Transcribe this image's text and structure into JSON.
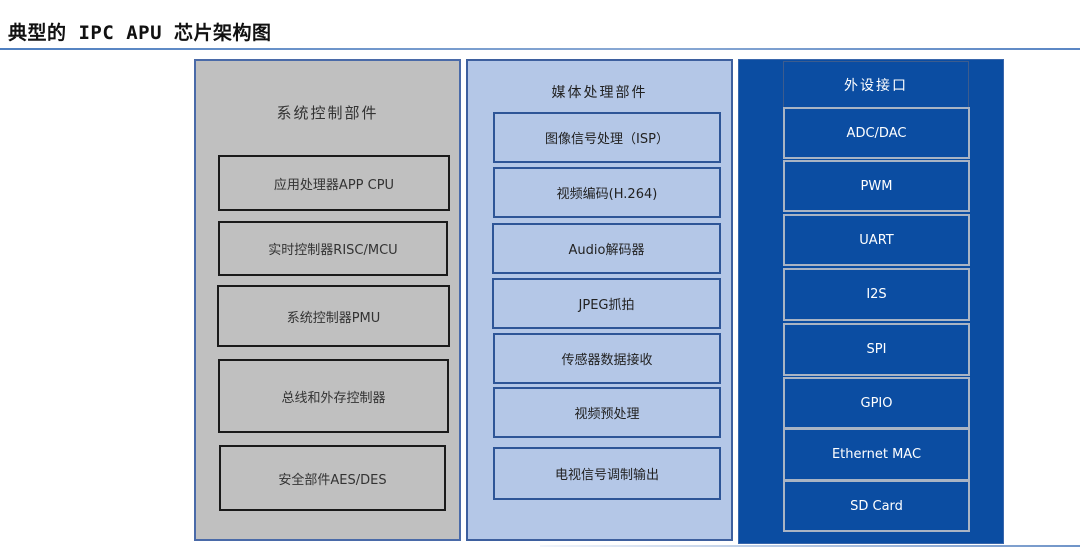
{
  "page": {
    "title": "典型的 IPC APU 芯片架构图"
  },
  "diagram": {
    "system_control": {
      "title": "系统控制部件",
      "items": [
        "应用处理器APP CPU",
        "实时控制器RISC/MCU",
        "系统控制器PMU",
        "总线和外存控制器",
        "安全部件AES/DES"
      ]
    },
    "media_processing": {
      "title": "媒体处理部件",
      "items": [
        "图像信号处理（ISP）",
        "视频编码(H.264)",
        "Audio解码器",
        "JPEG抓拍",
        "传感器数据接收",
        "视频预处理",
        "电视信号调制输出"
      ]
    },
    "peripheral_interfaces": {
      "title": "外设接口",
      "items": [
        "ADC/DAC",
        "PWM",
        "UART",
        "I2S",
        "SPI",
        "GPIO",
        "Ethernet MAC",
        "SD Card"
      ]
    },
    "colors": {
      "system_control_fill": "#c0c0c0",
      "media_processing_fill": "#b4c7e7",
      "peripheral_interfaces_fill": "#0b4da2"
    }
  }
}
